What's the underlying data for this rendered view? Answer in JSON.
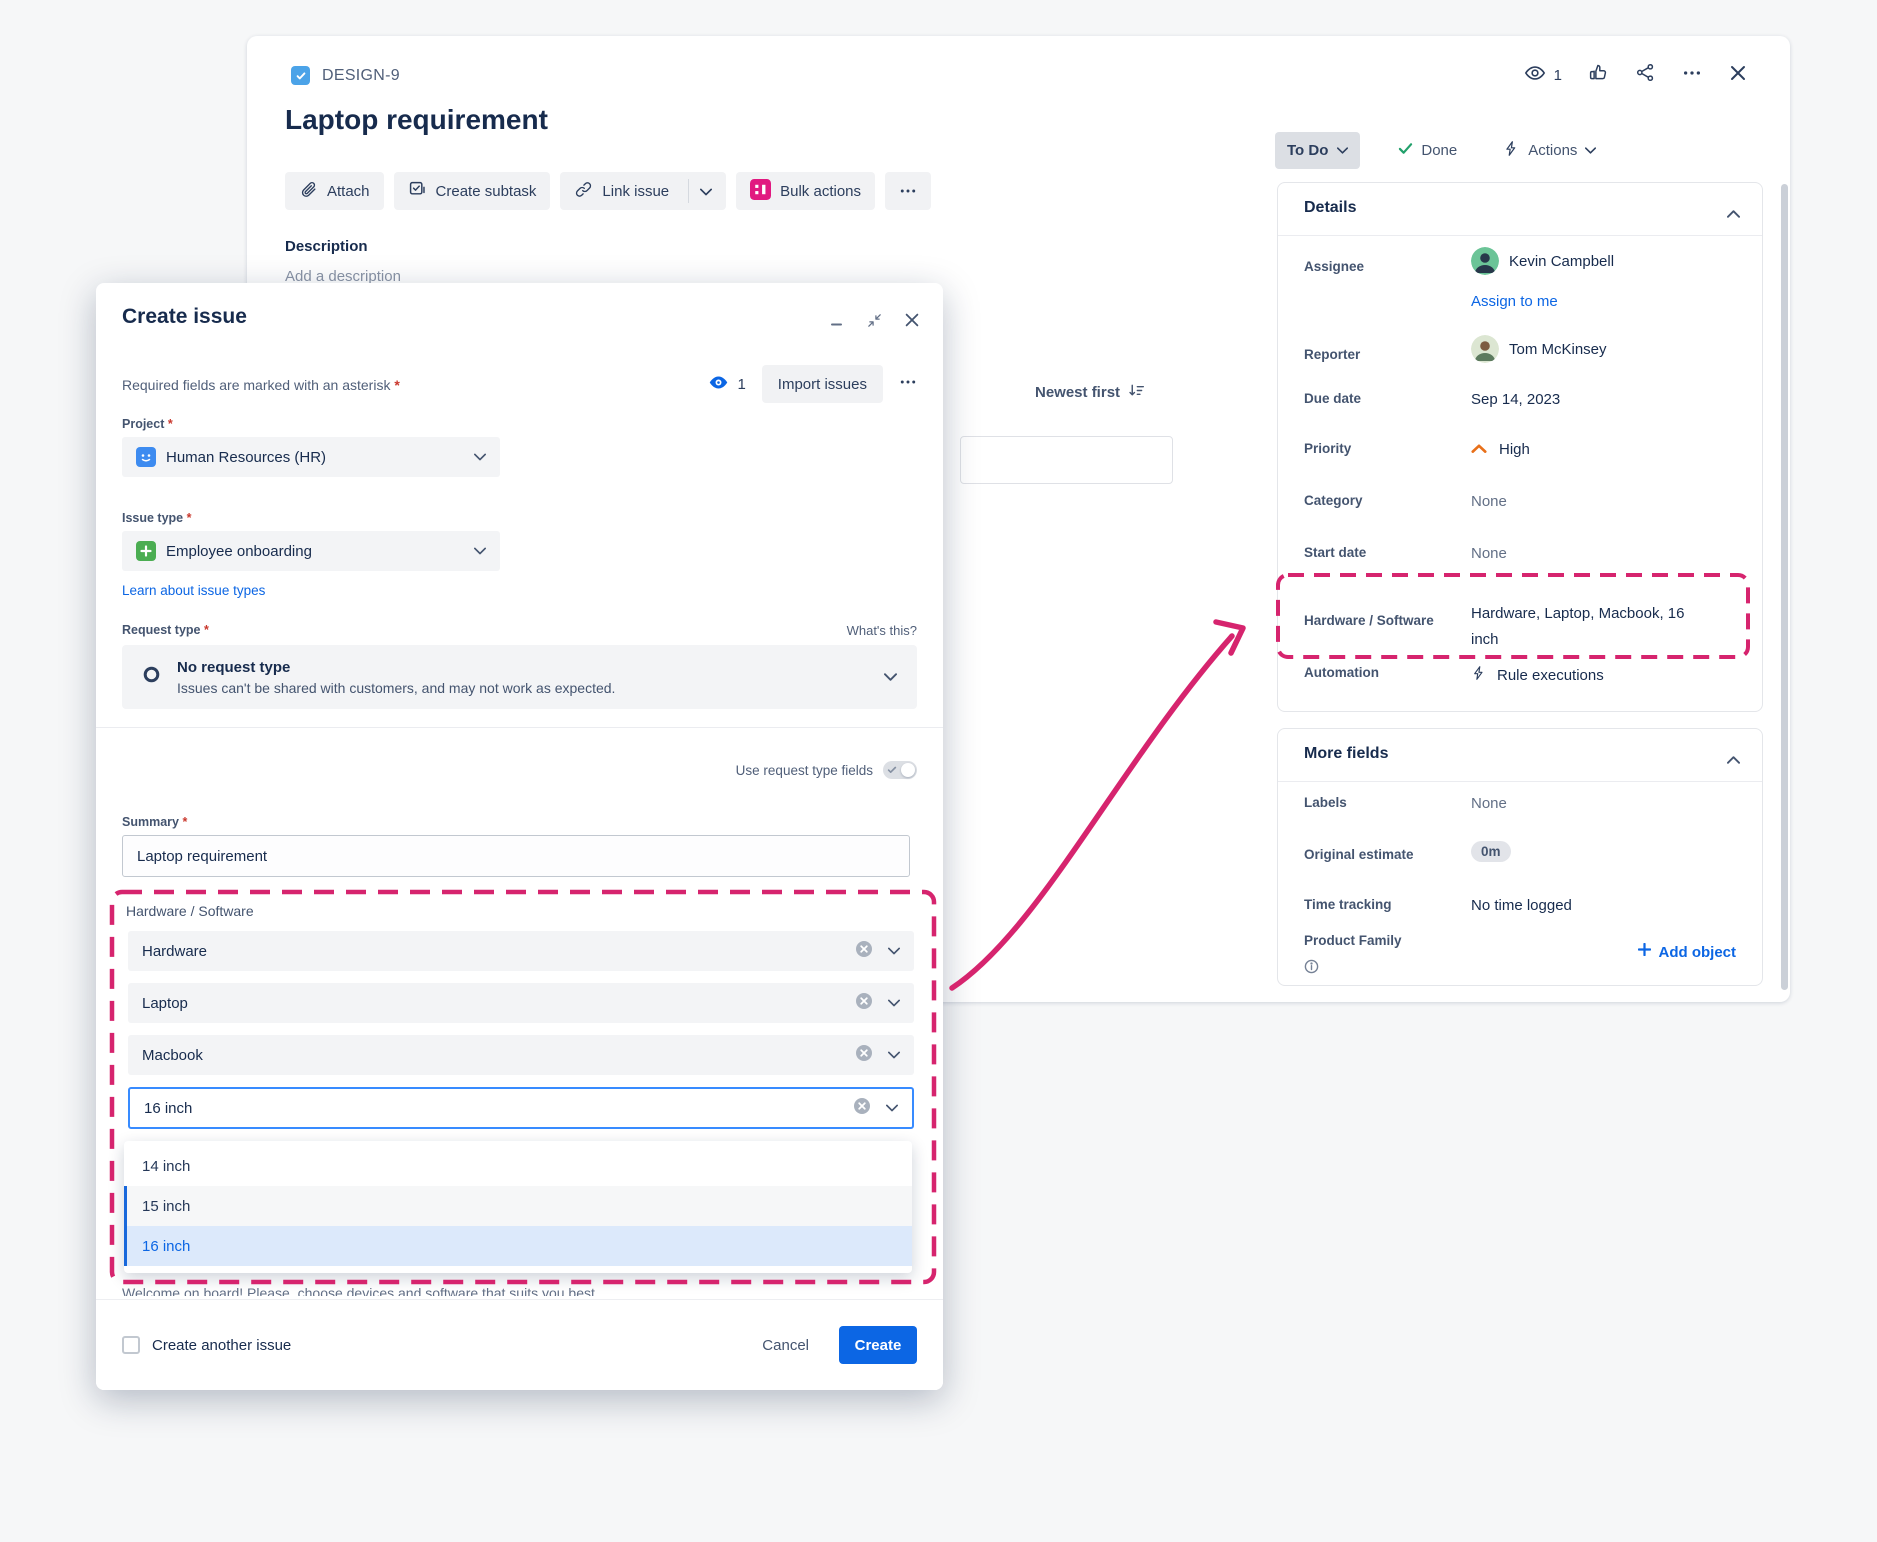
{
  "colors": {
    "highlight_pink": "#D6246E",
    "link_blue": "#0C66E4",
    "create_button_blue": "#0C66E4",
    "done_green": "#22A06B",
    "priority_orange": "#E8701A"
  },
  "issue": {
    "key": "DESIGN-9",
    "watchers": "1",
    "title": "Laptop requirement",
    "toolbar": {
      "attach": "Attach",
      "create_subtask": "Create subtask",
      "link_issue": "Link issue",
      "bulk_actions": "Bulk actions"
    },
    "description_label": "Description",
    "description_placeholder": "Add a description",
    "sort_label": "Newest first",
    "status_label": "To Do",
    "done_label": "Done",
    "actions_label": "Actions",
    "details": {
      "title": "Details",
      "assignee_label": "Assignee",
      "assignee": "Kevin Campbell",
      "assign_to_me": "Assign to me",
      "reporter_label": "Reporter",
      "reporter": "Tom McKinsey",
      "due_date_label": "Due date",
      "due_date": "Sep 14, 2023",
      "priority_label": "Priority",
      "priority": "High",
      "category_label": "Category",
      "category": "None",
      "start_date_label": "Start date",
      "start_date": "None",
      "hardware_label": "Hardware / Software",
      "hardware_value": "Hardware, Laptop, Macbook, 16 inch",
      "automation_label": "Automation",
      "automation_value": "Rule executions"
    },
    "more_fields": {
      "title": "More fields",
      "labels_label": "Labels",
      "labels": "None",
      "original_estimate_label": "Original estimate",
      "original_estimate": "0m",
      "time_tracking_label": "Time tracking",
      "time_tracking": "No time logged",
      "product_family_label": "Product Family",
      "add_object": "Add object"
    }
  },
  "modal": {
    "title": "Create issue",
    "required_note": "Required fields are marked with an asterisk",
    "asterisk": "*",
    "watchers": "1",
    "import_issues": "Import issues",
    "project_label": "Project",
    "project_value": "Human Resources (HR)",
    "issue_type_label": "Issue type",
    "issue_type_value": "Employee onboarding",
    "learn_link": "Learn about issue types",
    "request_type_label": "Request type",
    "whats_this": "What's this?",
    "request_type_title": "No request type",
    "request_type_desc": "Issues can't be shared with customers, and may not work as expected.",
    "use_request_fields": "Use request type fields",
    "summary_label": "Summary",
    "summary_value": "Laptop requirement",
    "hardware_label": "Hardware / Software",
    "hardware_values": [
      "Hardware",
      "Laptop",
      "Macbook",
      "16 inch"
    ],
    "dropdown_options": [
      "14 inch",
      "15 inch",
      "16 inch"
    ],
    "helper_text": "Welcome on board! Please, choose devices and software that suits you best",
    "create_another": "Create another issue",
    "cancel": "Cancel",
    "create": "Create"
  }
}
